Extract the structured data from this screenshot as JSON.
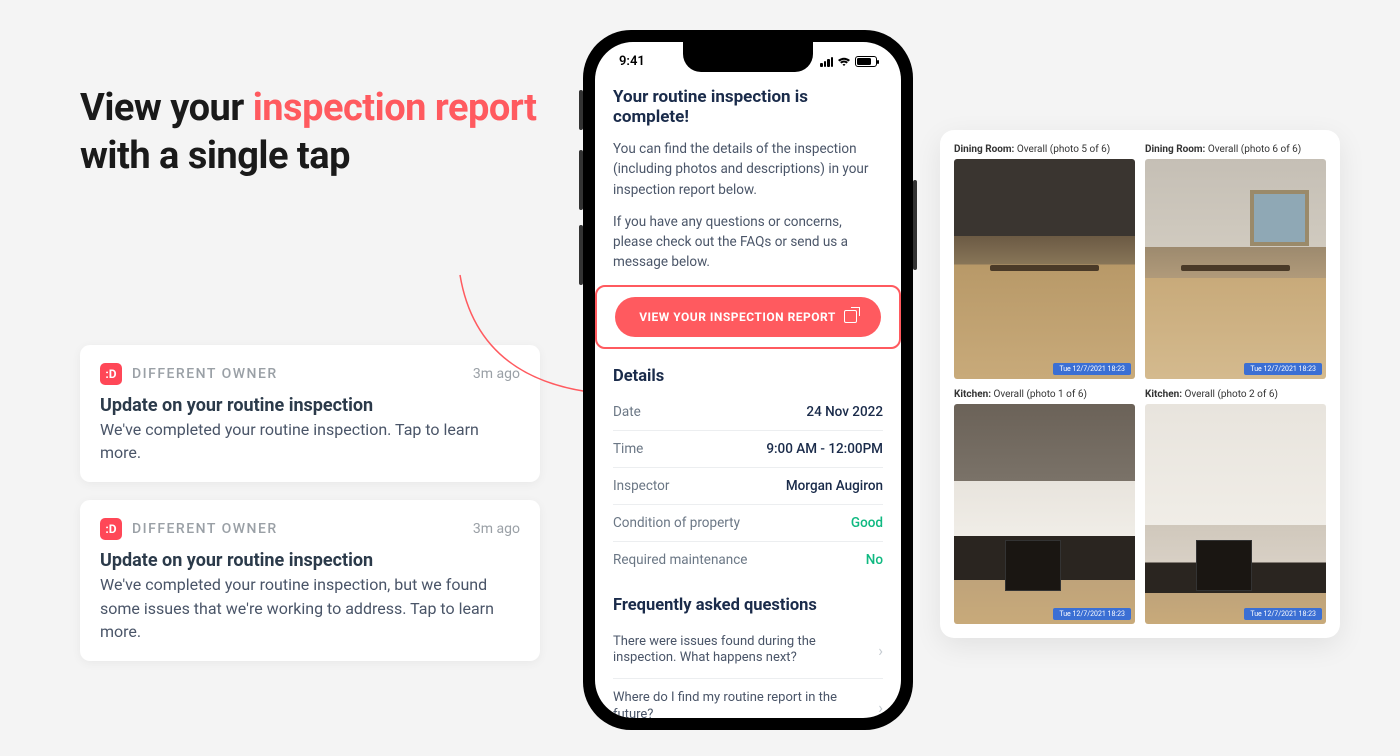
{
  "headline": {
    "part1": "View your ",
    "accent": "inspection report",
    "part2": " with a single tap"
  },
  "notifications": [
    {
      "app": "DIFFERENT OWNER",
      "time": "3m ago",
      "title": "Update on your routine inspection",
      "body": "We've completed your routine inspection. Tap to learn more."
    },
    {
      "app": "DIFFERENT OWNER",
      "time": "3m ago",
      "title": "Update on your routine inspection",
      "body": "We've completed your routine inspection, but we found some issues that we're working to address. Tap to learn more."
    }
  ],
  "phone": {
    "clock": "9:41",
    "heading": "Your routine inspection is complete!",
    "p1": "You can find the details of the inspection (including photos and descriptions) in your inspection report below.",
    "p2": "If you have any questions or concerns, please check out the FAQs or send us a message below.",
    "cta": "VIEW YOUR INSPECTION REPORT",
    "details_heading": "Details",
    "details": [
      {
        "label": "Date",
        "value": "24 Nov 2022",
        "good": false
      },
      {
        "label": "Time",
        "value": "9:00 AM - 12:00PM",
        "good": false
      },
      {
        "label": "Inspector",
        "value": "Morgan Augiron",
        "good": false
      },
      {
        "label": "Condition of property",
        "value": "Good",
        "good": true
      },
      {
        "label": "Required maintenance",
        "value": "No",
        "good": true
      }
    ],
    "faq_heading": "Frequently asked questions",
    "faqs": [
      "There were issues found during the inspection. What happens next?",
      "Where do I find my routine report in the future?"
    ]
  },
  "report": {
    "photos": [
      {
        "room": "Dining Room:",
        "desc": " Overall (photo 5 of 6)",
        "cls": "dining1",
        "tag": "Tue 12/7/2021 18:23"
      },
      {
        "room": "Dining Room:",
        "desc": " Overall (photo 6 of 6)",
        "cls": "dining2",
        "tag": "Tue 12/7/2021 18:23"
      },
      {
        "room": "Kitchen:",
        "desc": " Overall (photo 1 of 6)",
        "cls": "kitchen1",
        "tag": "Tue 12/7/2021 18:23"
      },
      {
        "room": "Kitchen:",
        "desc": " Overall (photo 2 of 6)",
        "cls": "kitchen2",
        "tag": "Tue 12/7/2021 18:23"
      }
    ]
  },
  "logo_text": ":D"
}
